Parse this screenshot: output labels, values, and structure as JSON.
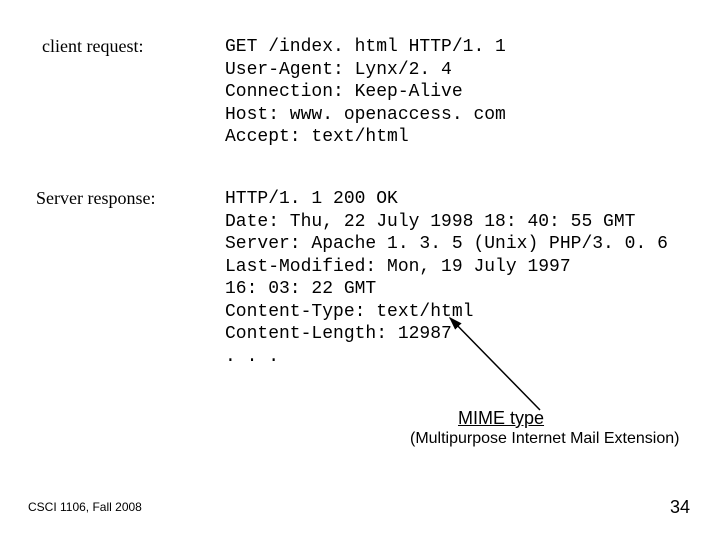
{
  "labels": {
    "client": "client request:",
    "server": "Server response:"
  },
  "request_lines": [
    "GET /index. html HTTP/1. 1",
    "User-Agent: Lynx/2. 4",
    "Connection: Keep-Alive",
    "Host: www. openaccess. com",
    "Accept: text/html"
  ],
  "response_lines": [
    "HTTP/1. 1 200 OK",
    "Date: Thu, 22 July 1998 18: 40: 55 GMT",
    "Server: Apache 1. 3. 5 (Unix) PHP/3. 0. 6",
    "Last-Modified: Mon, 19 July 1997",
    "16: 03: 22 GMT",
    "Content-Type: text/html",
    "Content-Length: 12987",
    ". . ."
  ],
  "mime": {
    "title": "MIME type",
    "subtitle": "(Multipurpose Internet Mail Extension)"
  },
  "footer": {
    "course": "CSCI 1106, Fall 2008",
    "page": "34"
  }
}
